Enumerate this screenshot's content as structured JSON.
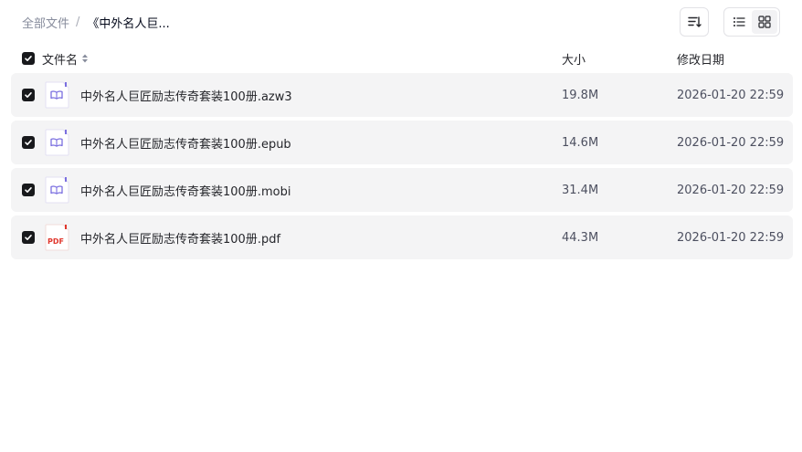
{
  "breadcrumb": {
    "root": "全部文件",
    "separator": "/",
    "current": "《中外名人巨..."
  },
  "toolbar": {
    "sort_icon": "sort-list-icon",
    "view_list_icon": "list-view-icon",
    "view_grid_icon": "grid-view-icon",
    "active_view": "list"
  },
  "header": {
    "select_all_checked": true,
    "name": "文件名",
    "size": "大小",
    "date": "修改日期"
  },
  "files": [
    {
      "name": "中外名人巨匠励志传奇套装100册.azw3",
      "size": "19.8M",
      "date": "2026-01-20 22:59",
      "type": "ebook",
      "checked": true
    },
    {
      "name": "中外名人巨匠励志传奇套装100册.epub",
      "size": "14.6M",
      "date": "2026-01-20 22:59",
      "type": "ebook",
      "checked": true
    },
    {
      "name": "中外名人巨匠励志传奇套装100册.mobi",
      "size": "31.4M",
      "date": "2026-01-20 22:59",
      "type": "ebook",
      "checked": true
    },
    {
      "name": "中外名人巨匠励志传奇套装100册.pdf",
      "size": "44.3M",
      "date": "2026-01-20 22:59",
      "type": "pdf",
      "checked": true,
      "icon_text": "PDF"
    }
  ],
  "colors": {
    "ebook_icon": "#7b6fe0",
    "pdf_icon": "#e0362c",
    "row_bg": "#f4f4f5",
    "checkbox": "#18191c"
  }
}
